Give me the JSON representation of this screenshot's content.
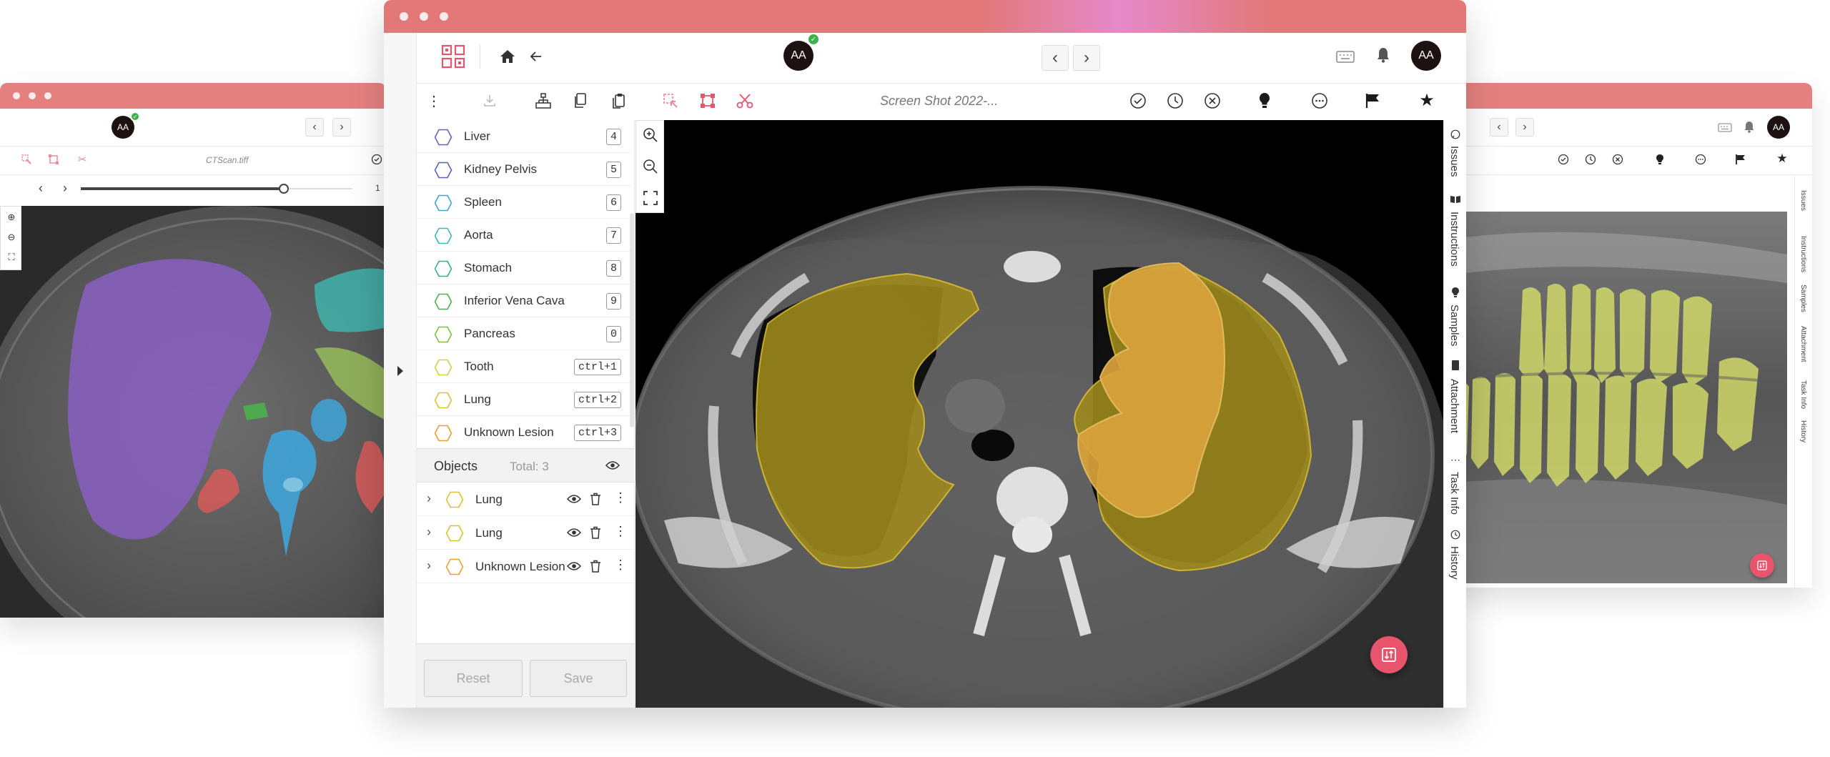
{
  "colors": {
    "titlebar": "#e58080",
    "accent": "#e8546b",
    "lung_fill": "#a08a1c",
    "lung_highlight": "#d9a33c",
    "liver_purple": "#8a5fc2",
    "teeth_yellow": "#d7e06a"
  },
  "left_window": {
    "avatar": "AA",
    "filename": "CTScan.tiff",
    "slice_value": "1"
  },
  "main_window": {
    "avatar": "AA",
    "user_avatar": "AA",
    "filename": "Screen Shot 2022-...",
    "classes": [
      {
        "name": "Liver",
        "key": "4",
        "color": "#6d5fb8"
      },
      {
        "name": "Kidney Pelvis",
        "key": "5",
        "color": "#5b5fc4"
      },
      {
        "name": "Spleen",
        "key": "6",
        "color": "#3fa4d8"
      },
      {
        "name": "Aorta",
        "key": "7",
        "color": "#3fb8c0"
      },
      {
        "name": "Stomach",
        "key": "8",
        "color": "#3ea890"
      },
      {
        "name": "Inferior Vena Cava",
        "key": "9",
        "color": "#4cb04c"
      },
      {
        "name": "Pancreas",
        "key": "0",
        "color": "#7cbf3e"
      },
      {
        "name": "Tooth",
        "key": "ctrl+1",
        "color": "#d0d040"
      },
      {
        "name": "Lung",
        "key": "ctrl+2",
        "color": "#e0c030"
      },
      {
        "name": "Unknown Lesion",
        "key": "ctrl+3",
        "color": "#e8a030"
      }
    ],
    "objects_header": {
      "label": "Objects",
      "total": "Total: 3"
    },
    "objects": [
      {
        "name": "Lung",
        "color": "#e0c030"
      },
      {
        "name": "Lung",
        "color": "#e0c030"
      },
      {
        "name": "Unknown Lesion",
        "color": "#e8a030"
      }
    ],
    "reset_label": "Reset",
    "save_label": "Save",
    "side_tabs": [
      "Issues",
      "Instructions",
      "Samples",
      "Attachment",
      "Task Info",
      "History"
    ]
  },
  "right_window": {
    "avatar": "AA",
    "side_tabs": [
      "Issues",
      "Instructions",
      "Samples",
      "Attachment",
      "Task Info",
      "History"
    ]
  },
  "icons": [
    "grid-logo-icon",
    "home-icon",
    "back-arrow-icon",
    "chevron-left-icon",
    "chevron-right-icon",
    "keyboard-icon",
    "bell-icon",
    "more-vertical-icon",
    "download-icon",
    "hierarchy-icon",
    "copy-icon",
    "paste-icon",
    "select-tool-icon",
    "box-select-icon",
    "scissors-icon",
    "approve-icon",
    "reset-status-icon",
    "reject-icon",
    "hint-bulb-icon",
    "comment-icon",
    "flag-icon",
    "star-icon",
    "zoom-in-icon",
    "zoom-out-icon",
    "fullscreen-icon",
    "eye-icon",
    "trash-icon",
    "compare-icon",
    "expand-panel-icon"
  ]
}
